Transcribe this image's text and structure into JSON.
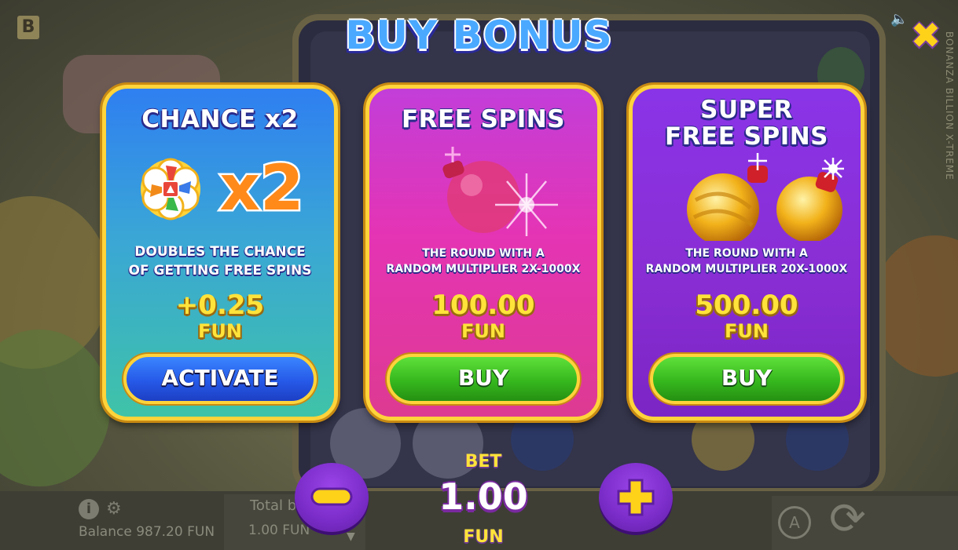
{
  "background": {
    "brand_letter": "B",
    "side_text": "BONANZA BILLION X-TREME",
    "balance_text": "Balance 987.20 FUN",
    "total_bet_label": "Total b",
    "total_bet_value": "1.00 FUN",
    "auto_label": "A"
  },
  "modal": {
    "title": "BUY BONUS",
    "close_icon": "close-x-icon"
  },
  "cards": [
    {
      "title_lines": [
        "CHANCE x2"
      ],
      "desc_lines": [
        "DOUBLES THE CHANCE",
        "OF GETTING FREE SPINS"
      ],
      "price": "+0.25",
      "currency": "FUN",
      "button": "ACTIVATE",
      "art_text": "x2",
      "art_icon": "flower-badge-icon"
    },
    {
      "title_lines": [
        "FREE SPINS"
      ],
      "desc_lines": [
        "THE ROUND WITH A",
        "RANDOM MULTIPLIER 2X-1000X"
      ],
      "price": "100.00",
      "currency": "FUN",
      "button": "BUY",
      "art_icon": "pink-bomb-icon"
    },
    {
      "title_lines": [
        "SUPER",
        "FREE SPINS"
      ],
      "desc_lines": [
        "THE ROUND WITH A",
        "RANDOM MULTIPLIER 20X-1000X"
      ],
      "price": "500.00",
      "currency": "FUN",
      "button": "BUY",
      "art_icon": "gold-bombs-icon"
    }
  ],
  "bet": {
    "label": "BET",
    "value": "1.00",
    "currency": "FUN"
  },
  "colors": {
    "card1": "#2f7ff1",
    "card2": "#e534b4",
    "card3": "#8a2fd6",
    "gold": "#ffd33a",
    "price": "#ffe33a"
  }
}
